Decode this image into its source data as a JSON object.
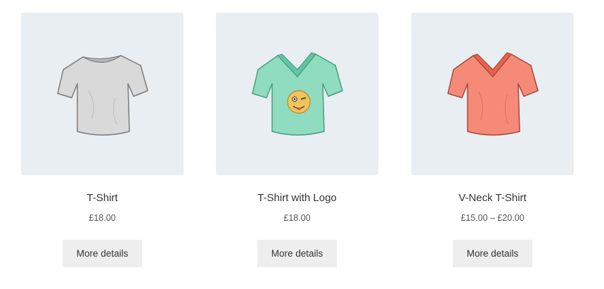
{
  "products": [
    {
      "name": "T-Shirt",
      "price": "£18.00",
      "button_label": "More details",
      "image_icon": "tshirt-crew-gray-icon",
      "shirt_color": "#d9d9d9",
      "collar_color": "#b8b8b8"
    },
    {
      "name": "T-Shirt with Logo",
      "price": "£18.00",
      "button_label": "More details",
      "image_icon": "tshirt-vneck-teal-logo-icon",
      "shirt_color": "#8fdcc0",
      "collar_color": "#5fc7a4",
      "logo_color": "#f2c35a"
    },
    {
      "name": "V-Neck T-Shirt",
      "price": "£15.00 – £20.00",
      "button_label": "More details",
      "image_icon": "tshirt-vneck-coral-icon",
      "shirt_color": "#f58a78",
      "collar_color": "#e8624f"
    }
  ]
}
